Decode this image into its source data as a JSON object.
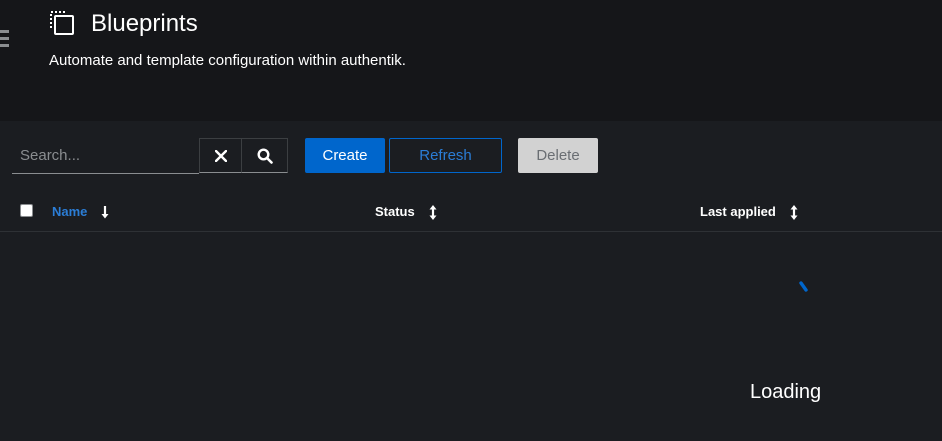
{
  "page": {
    "title": "Blueprints",
    "subtitle": "Automate and template configuration within authentik.",
    "title_icon": "blueprint-icon"
  },
  "toolbar": {
    "search_placeholder": "Search...",
    "search_value": "",
    "clear_icon": "close-icon",
    "search_icon": "search-icon",
    "create_label": "Create",
    "refresh_label": "Refresh",
    "delete_label": "Delete"
  },
  "table": {
    "columns": [
      {
        "label": "Name",
        "sort": "descending",
        "active": true
      },
      {
        "label": "Status",
        "sort": "none",
        "active": false
      },
      {
        "label": "Last applied",
        "sort": "none",
        "active": false
      }
    ]
  },
  "state": {
    "loading_label": "Loading"
  },
  "colors": {
    "accent": "#0066cc",
    "link": "#2b7dd6",
    "background": "#1b1d21",
    "header_bg": "#151619"
  }
}
